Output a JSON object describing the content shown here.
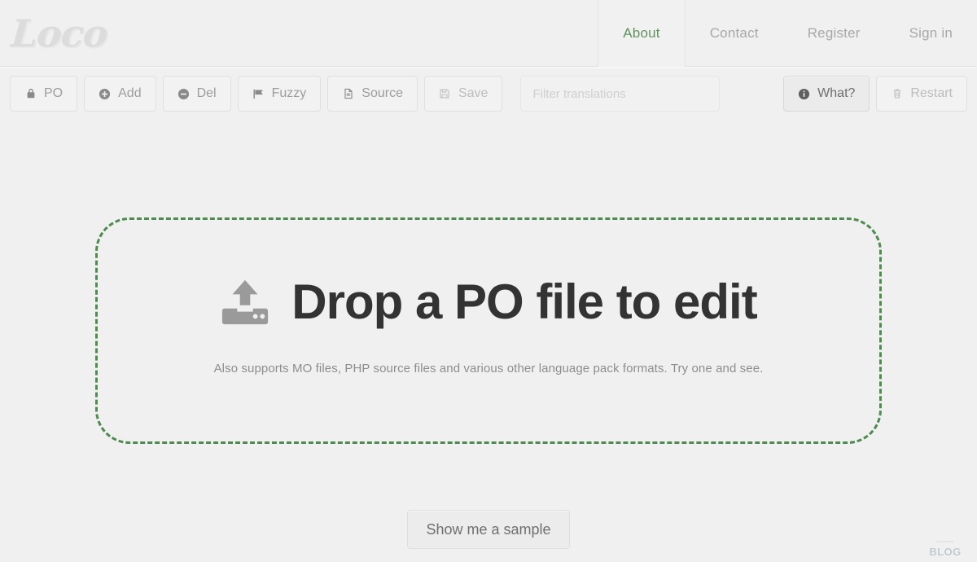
{
  "header": {
    "logo_text": "Loco",
    "nav": [
      {
        "label": "About",
        "active": true
      },
      {
        "label": "Contact",
        "active": false
      },
      {
        "label": "Register",
        "active": false
      },
      {
        "label": "Sign in",
        "active": false
      }
    ]
  },
  "toolbar": {
    "buttons": [
      {
        "label": "PO",
        "icon": "lock-icon"
      },
      {
        "label": "Add",
        "icon": "plus-circle-icon"
      },
      {
        "label": "Del",
        "icon": "minus-circle-icon"
      },
      {
        "label": "Fuzzy",
        "icon": "flag-icon"
      },
      {
        "label": "Source",
        "icon": "file-icon"
      },
      {
        "label": "Save",
        "icon": "floppy-disk-icon"
      }
    ],
    "filter": {
      "value": "",
      "placeholder": "Filter translations"
    },
    "right_buttons": [
      {
        "label": "What?",
        "icon": "info-circle-icon"
      },
      {
        "label": "Restart",
        "icon": "trash-icon"
      }
    ]
  },
  "dropzone": {
    "icon": "upload-icon",
    "title": "Drop a PO file to edit",
    "subtitle": "Also supports MO files, PHP source files and various other language pack formats. Try one and see."
  },
  "footer": {
    "sample_button": "Show me a sample",
    "watermark_top": "········",
    "watermark_bottom": "BLOG"
  },
  "colors": {
    "page_background": "#f0f0f0",
    "accent_green": "#5f9160",
    "dropzone_border": "#4f8a50",
    "heading": "#333333",
    "muted_text": "#9d9d9d"
  }
}
